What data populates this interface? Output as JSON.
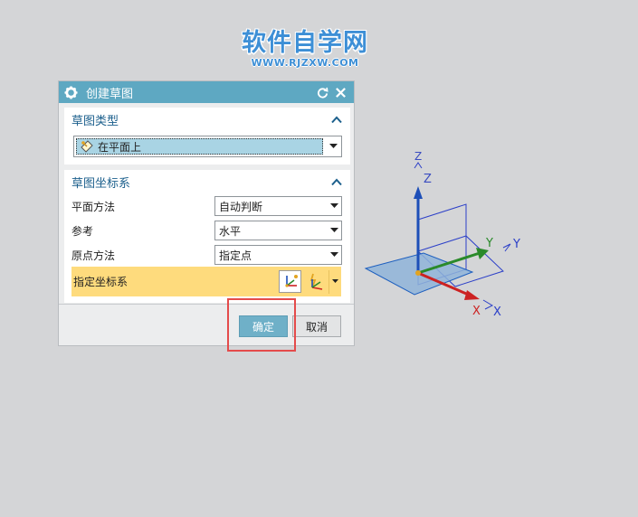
{
  "watermark": {
    "title": "软件自学网",
    "url": "WWW.RJZXW.COM"
  },
  "dialog": {
    "title": "创建草图",
    "sketch_type": {
      "header": "草图类型",
      "selected": "在平面上"
    },
    "sketch_csys": {
      "header": "草图坐标系",
      "fields": [
        {
          "label": "平面方法",
          "value": "自动判断"
        },
        {
          "label": "参考",
          "value": "水平"
        },
        {
          "label": "原点方法",
          "value": "指定点"
        }
      ],
      "specify_csys_label": "指定坐标系"
    },
    "buttons": {
      "ok": "确定",
      "cancel": "取消"
    }
  },
  "triad": {
    "z_label": "Z",
    "z_label2": "Z",
    "y_label": "Y",
    "y_label2": "Y",
    "x_label": "X",
    "x_label2": "X"
  },
  "colors": {
    "titlebar": "#5ea8c2",
    "highlight_border": "#e44b4b",
    "csys_row": "#fedb7d",
    "ok_button": "#6fb0c8"
  }
}
